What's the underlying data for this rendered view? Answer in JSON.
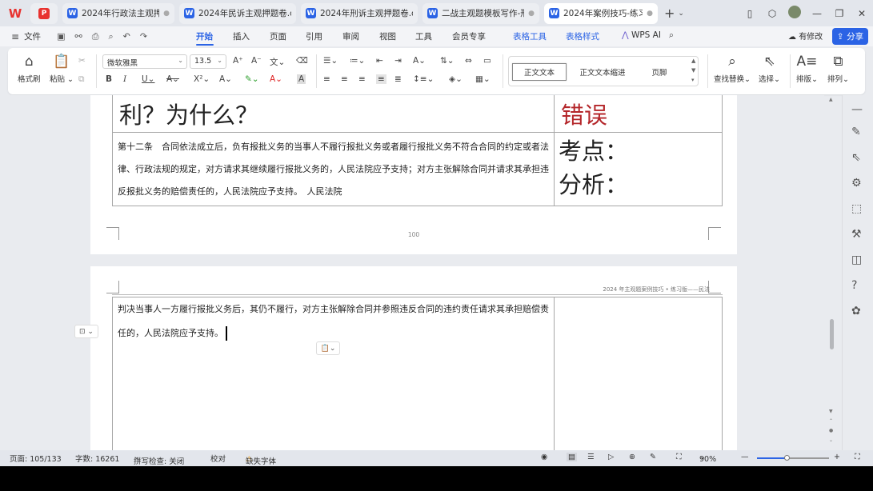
{
  "tabs": [
    {
      "label": "2024年行政法主观押题",
      "icon": "word-icon"
    },
    {
      "label": "2024年民诉主观押题卷.do",
      "icon": "word-icon"
    },
    {
      "label": "2024年刑诉主观押题卷.do",
      "icon": "word-icon"
    },
    {
      "label": "二战主观题模板写作-刑",
      "icon": "word-icon"
    },
    {
      "label": "2024年案例技巧-练习版",
      "icon": "word-icon",
      "active": true
    }
  ],
  "menu": {
    "file": "文件",
    "items": [
      "开始",
      "插入",
      "页面",
      "引用",
      "审阅",
      "视图",
      "工具",
      "会员专享"
    ],
    "table_tools": "表格工具",
    "table_style": "表格样式",
    "wps_ai": "WPS AI",
    "modified": "有修改",
    "share": "分享"
  },
  "ribbon": {
    "format_painter": "格式刷",
    "paste": "粘贴",
    "font": "微软雅黑",
    "font_size": "13.5",
    "styles": [
      "正文文本",
      "正文文本缩进",
      "页脚"
    ],
    "find_replace": "查找替换",
    "select": "选择",
    "arrange": "排版",
    "order": "排列"
  },
  "page1": {
    "question_tail": "利？为什么？",
    "verdict": "错误",
    "law_text": "第十二条　合同依法成立后，负有报批义务的当事人不履行报批义务或者履行报批义务不符合合同的约定或者法律、行政法规的规定，对方请求其继续履行报批义务的，人民法院应予支持；对方主张解除合同并请求其承担违反报批义务的赔偿责任的，人民法院应予支持。　人民法院",
    "point_label": "考点：",
    "analysis_label": "分析：",
    "page_number": "100"
  },
  "page2": {
    "header": "2024 年主观题案例技巧 • 练习版——民法",
    "text": "判决当事人一方履行报批义务后，其仍不履行，对方主张解除合同并参照违反合同的违约责任请求其承担赔偿责任的，人民法院应予支持。"
  },
  "status": {
    "page": "页面: 105/133",
    "words": "字数: 16261",
    "spell": "拼写检查: 关闭",
    "proof": "校对",
    "missing_font": "缺失字体",
    "zoom": "90%",
    "zoom_level": 0.42
  }
}
